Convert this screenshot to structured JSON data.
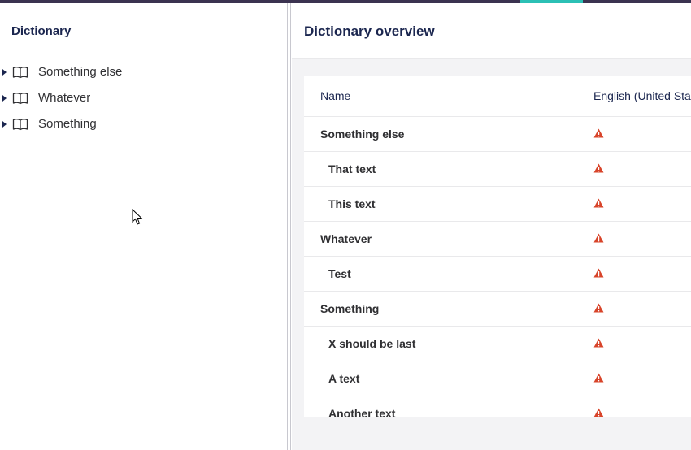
{
  "sidebar": {
    "title": "Dictionary",
    "items": [
      {
        "label": "Something else",
        "icon": "book-icon"
      },
      {
        "label": "Whatever",
        "icon": "book-icon"
      },
      {
        "label": "Something",
        "icon": "book-icon"
      }
    ]
  },
  "main": {
    "title": "Dictionary overview",
    "table": {
      "columns": [
        "Name",
        "English (United Stat"
      ],
      "rows": [
        {
          "name": "Something else",
          "level": 0,
          "status": "warning-icon"
        },
        {
          "name": "That text",
          "level": 1,
          "status": "warning-icon"
        },
        {
          "name": "This text",
          "level": 1,
          "status": "warning-icon"
        },
        {
          "name": "Whatever",
          "level": 0,
          "status": "warning-icon"
        },
        {
          "name": "Test",
          "level": 1,
          "status": "warning-icon"
        },
        {
          "name": "Something",
          "level": 0,
          "status": "warning-icon"
        },
        {
          "name": "X should be last",
          "level": 1,
          "status": "warning-icon"
        },
        {
          "name": "A text",
          "level": 1,
          "status": "warning-icon"
        },
        {
          "name": "Another text",
          "level": 1,
          "status": "warning-icon"
        }
      ]
    }
  },
  "colors": {
    "topbar": "#3b3350",
    "accent": "#2bc0b5",
    "warning": "#d8442a",
    "text": "#1b264f"
  }
}
